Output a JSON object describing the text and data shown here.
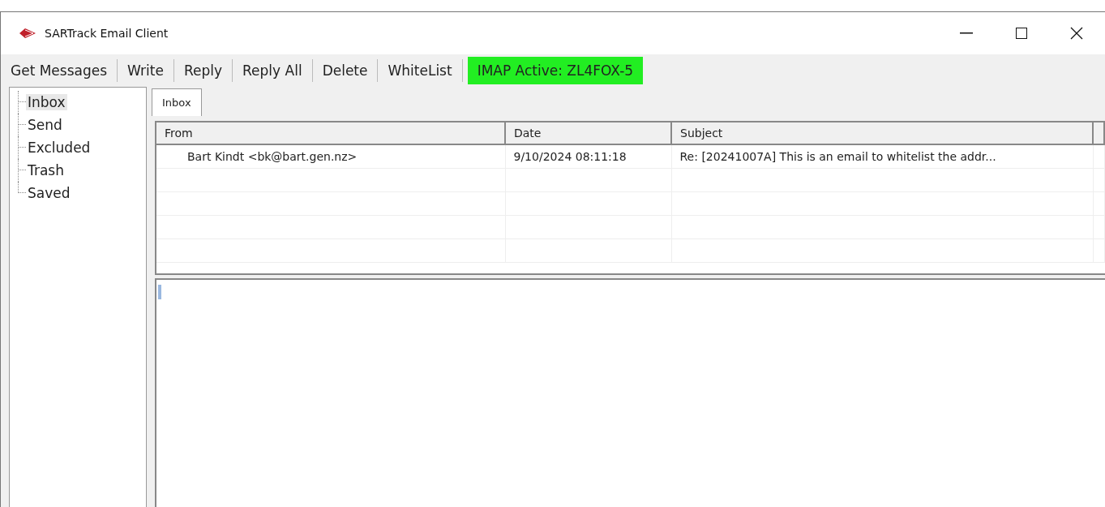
{
  "window": {
    "title": "SARTrack Email Client"
  },
  "toolbar": [
    {
      "kind": "button",
      "label": "Get Messages"
    },
    {
      "kind": "button",
      "label": "Write"
    },
    {
      "kind": "button",
      "label": "Reply"
    },
    {
      "kind": "button",
      "label": "Reply All"
    },
    {
      "kind": "button",
      "label": "Delete"
    },
    {
      "kind": "button",
      "label": "WhiteList"
    },
    {
      "kind": "status",
      "label": "IMAP Active: ZL4FOX-5",
      "color": "#22ee22"
    }
  ],
  "sidebar": {
    "items": [
      {
        "label": "Inbox",
        "selected": true
      },
      {
        "label": "Send",
        "selected": false
      },
      {
        "label": "Excluded",
        "selected": false
      },
      {
        "label": "Trash",
        "selected": false
      },
      {
        "label": "Saved",
        "selected": false
      }
    ]
  },
  "tabs": [
    {
      "label": "Inbox",
      "selected": true
    }
  ],
  "table": {
    "columns": [
      "From",
      "Date",
      "Subject"
    ],
    "rows": [
      [
        "Bart Kindt <bk@bart.gen.nz>",
        "9/10/2024 08:11:18",
        "Re: [20241007A] This is an email to whitelist the addr..."
      ]
    ]
  }
}
